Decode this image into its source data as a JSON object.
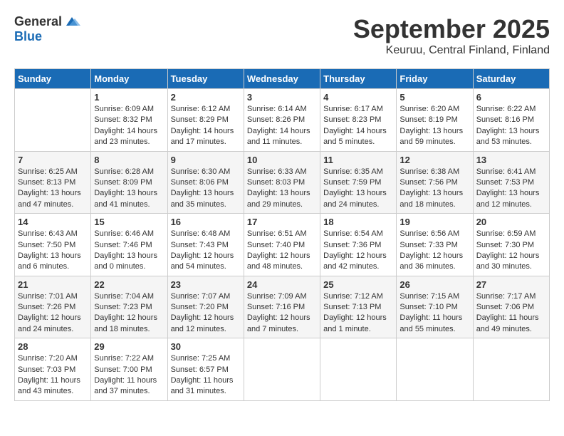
{
  "logo": {
    "general": "General",
    "blue": "Blue"
  },
  "title": "September 2025",
  "location": "Keuruu, Central Finland, Finland",
  "days_header": [
    "Sunday",
    "Monday",
    "Tuesday",
    "Wednesday",
    "Thursday",
    "Friday",
    "Saturday"
  ],
  "weeks": [
    [
      {
        "day": "",
        "info": ""
      },
      {
        "day": "1",
        "info": "Sunrise: 6:09 AM\nSunset: 8:32 PM\nDaylight: 14 hours\nand 23 minutes."
      },
      {
        "day": "2",
        "info": "Sunrise: 6:12 AM\nSunset: 8:29 PM\nDaylight: 14 hours\nand 17 minutes."
      },
      {
        "day": "3",
        "info": "Sunrise: 6:14 AM\nSunset: 8:26 PM\nDaylight: 14 hours\nand 11 minutes."
      },
      {
        "day": "4",
        "info": "Sunrise: 6:17 AM\nSunset: 8:23 PM\nDaylight: 14 hours\nand 5 minutes."
      },
      {
        "day": "5",
        "info": "Sunrise: 6:20 AM\nSunset: 8:19 PM\nDaylight: 13 hours\nand 59 minutes."
      },
      {
        "day": "6",
        "info": "Sunrise: 6:22 AM\nSunset: 8:16 PM\nDaylight: 13 hours\nand 53 minutes."
      }
    ],
    [
      {
        "day": "7",
        "info": "Sunrise: 6:25 AM\nSunset: 8:13 PM\nDaylight: 13 hours\nand 47 minutes."
      },
      {
        "day": "8",
        "info": "Sunrise: 6:28 AM\nSunset: 8:09 PM\nDaylight: 13 hours\nand 41 minutes."
      },
      {
        "day": "9",
        "info": "Sunrise: 6:30 AM\nSunset: 8:06 PM\nDaylight: 13 hours\nand 35 minutes."
      },
      {
        "day": "10",
        "info": "Sunrise: 6:33 AM\nSunset: 8:03 PM\nDaylight: 13 hours\nand 29 minutes."
      },
      {
        "day": "11",
        "info": "Sunrise: 6:35 AM\nSunset: 7:59 PM\nDaylight: 13 hours\nand 24 minutes."
      },
      {
        "day": "12",
        "info": "Sunrise: 6:38 AM\nSunset: 7:56 PM\nDaylight: 13 hours\nand 18 minutes."
      },
      {
        "day": "13",
        "info": "Sunrise: 6:41 AM\nSunset: 7:53 PM\nDaylight: 13 hours\nand 12 minutes."
      }
    ],
    [
      {
        "day": "14",
        "info": "Sunrise: 6:43 AM\nSunset: 7:50 PM\nDaylight: 13 hours\nand 6 minutes."
      },
      {
        "day": "15",
        "info": "Sunrise: 6:46 AM\nSunset: 7:46 PM\nDaylight: 13 hours\nand 0 minutes."
      },
      {
        "day": "16",
        "info": "Sunrise: 6:48 AM\nSunset: 7:43 PM\nDaylight: 12 hours\nand 54 minutes."
      },
      {
        "day": "17",
        "info": "Sunrise: 6:51 AM\nSunset: 7:40 PM\nDaylight: 12 hours\nand 48 minutes."
      },
      {
        "day": "18",
        "info": "Sunrise: 6:54 AM\nSunset: 7:36 PM\nDaylight: 12 hours\nand 42 minutes."
      },
      {
        "day": "19",
        "info": "Sunrise: 6:56 AM\nSunset: 7:33 PM\nDaylight: 12 hours\nand 36 minutes."
      },
      {
        "day": "20",
        "info": "Sunrise: 6:59 AM\nSunset: 7:30 PM\nDaylight: 12 hours\nand 30 minutes."
      }
    ],
    [
      {
        "day": "21",
        "info": "Sunrise: 7:01 AM\nSunset: 7:26 PM\nDaylight: 12 hours\nand 24 minutes."
      },
      {
        "day": "22",
        "info": "Sunrise: 7:04 AM\nSunset: 7:23 PM\nDaylight: 12 hours\nand 18 minutes."
      },
      {
        "day": "23",
        "info": "Sunrise: 7:07 AM\nSunset: 7:20 PM\nDaylight: 12 hours\nand 12 minutes."
      },
      {
        "day": "24",
        "info": "Sunrise: 7:09 AM\nSunset: 7:16 PM\nDaylight: 12 hours\nand 7 minutes."
      },
      {
        "day": "25",
        "info": "Sunrise: 7:12 AM\nSunset: 7:13 PM\nDaylight: 12 hours\nand 1 minute."
      },
      {
        "day": "26",
        "info": "Sunrise: 7:15 AM\nSunset: 7:10 PM\nDaylight: 11 hours\nand 55 minutes."
      },
      {
        "day": "27",
        "info": "Sunrise: 7:17 AM\nSunset: 7:06 PM\nDaylight: 11 hours\nand 49 minutes."
      }
    ],
    [
      {
        "day": "28",
        "info": "Sunrise: 7:20 AM\nSunset: 7:03 PM\nDaylight: 11 hours\nand 43 minutes."
      },
      {
        "day": "29",
        "info": "Sunrise: 7:22 AM\nSunset: 7:00 PM\nDaylight: 11 hours\nand 37 minutes."
      },
      {
        "day": "30",
        "info": "Sunrise: 7:25 AM\nSunset: 6:57 PM\nDaylight: 11 hours\nand 31 minutes."
      },
      {
        "day": "",
        "info": ""
      },
      {
        "day": "",
        "info": ""
      },
      {
        "day": "",
        "info": ""
      },
      {
        "day": "",
        "info": ""
      }
    ]
  ]
}
